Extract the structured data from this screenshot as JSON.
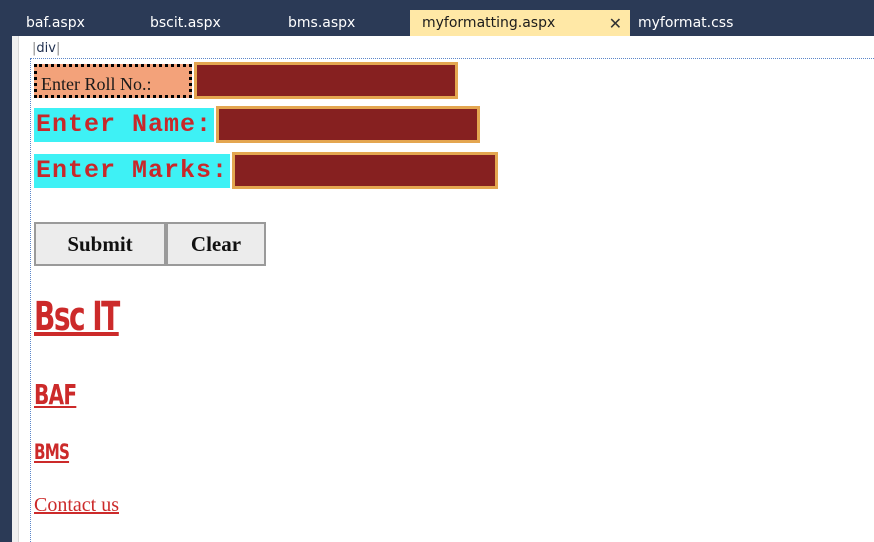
{
  "tabs": [
    {
      "label": "baf.aspx",
      "active": false
    },
    {
      "label": "bscit.aspx",
      "active": false
    },
    {
      "label": "bms.aspx",
      "active": false
    },
    {
      "label": "myformatting.aspx",
      "active": true
    },
    {
      "label": "myformat.css",
      "active": false
    }
  ],
  "editor": {
    "element_tag": "div"
  },
  "form": {
    "roll_label": "Enter Roll No.:",
    "name_label": "Enter Name:",
    "marks_label": "Enter Marks:",
    "roll_value": "",
    "name_value": "",
    "marks_value": "",
    "submit_label": "Submit",
    "clear_label": "Clear"
  },
  "links": {
    "bscit": "Bsc IT",
    "baf": "BAF",
    "bms": "BMS",
    "contact": "Contact us"
  },
  "colors": {
    "tab_bar": "#2b3a56",
    "active_tab": "#ffe8a6",
    "roll_label_bg": "#f3a27a",
    "mono_label_bg": "#3ef1f5",
    "label_text": "#c8282a",
    "input_bg": "#862020",
    "input_border": "#e4a650",
    "link": "#cc2a2a"
  },
  "icons": {
    "tab_close": "close-icon"
  }
}
